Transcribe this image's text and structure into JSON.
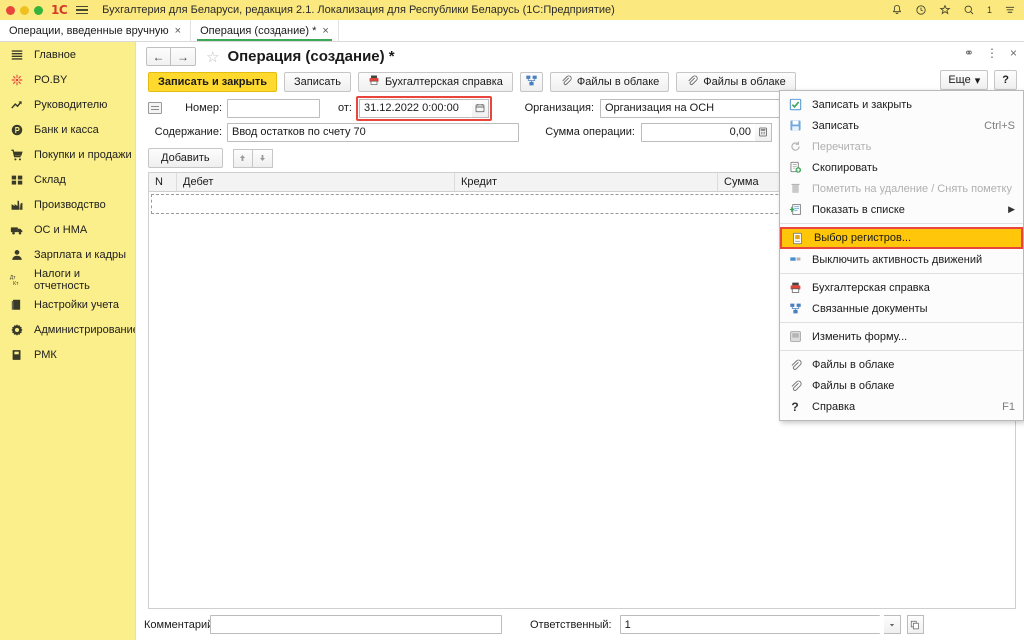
{
  "window": {
    "title": "Бухгалтерия для Беларуси, редакция 2.1. Локализация для Республики Беларусь   (1С:Предприятие)",
    "logo": "1С",
    "traffic_icons": [
      "close-red",
      "minimize-yellow",
      "zoom-green"
    ],
    "burger_icon": "hamburger-menu-icon",
    "right_icons": [
      {
        "name": "bell-icon",
        "glyph": "⚑"
      },
      {
        "name": "history-clock-icon",
        "glyph": "↺"
      },
      {
        "name": "favorites-star-icon",
        "glyph": "☆"
      },
      {
        "name": "search-icon",
        "glyph": "⚲"
      }
    ],
    "counter": "1",
    "menu_icon": "list-menu-icon"
  },
  "tabs": [
    {
      "label": "Операции, введенные вручную",
      "active": false,
      "close": "×"
    },
    {
      "label": "Операция (создание) *",
      "active": true,
      "close": "×"
    }
  ],
  "sidebar": {
    "items": [
      {
        "label": "Главное",
        "icon": "grid-lines-icon"
      },
      {
        "label": "РО.BY",
        "icon": "sparkle-icon"
      },
      {
        "label": "Руководителю",
        "icon": "trend-up-icon"
      },
      {
        "label": "Банк и касса",
        "icon": "coin-icon"
      },
      {
        "label": "Покупки и продажи",
        "icon": "cart-icon"
      },
      {
        "label": "Склад",
        "icon": "boxes-icon"
      },
      {
        "label": "Производство",
        "icon": "factory-icon"
      },
      {
        "label": "ОС и НМА",
        "icon": "truck-icon"
      },
      {
        "label": "Зарплата и кадры",
        "icon": "person-icon"
      },
      {
        "label": "Налоги и отчетность",
        "icon": "debit-credit-icon"
      },
      {
        "label": "Настройки учета",
        "icon": "books-icon"
      },
      {
        "label": "Администрирование",
        "icon": "gear-icon"
      },
      {
        "label": "РМК",
        "icon": "register-icon"
      }
    ]
  },
  "form": {
    "nav_back": "←",
    "nav_forward": "→",
    "favorite_star": "☆",
    "title": "Операция (создание) *",
    "header_actions": [
      {
        "name": "link-icon",
        "glyph": "⚭"
      },
      {
        "name": "more-vertical-icon",
        "glyph": "⋮"
      },
      {
        "name": "close-icon",
        "glyph": "×"
      }
    ],
    "toolbar": {
      "save_and_close": "Записать и закрыть",
      "save": "Записать",
      "accounting_reference": "Бухгалтерская справка",
      "print_icon": "printer-icon",
      "related_documents_icon": "related-documents-icon",
      "cloud_files_1": "Файлы в облаке",
      "cloud_files_2": "Файлы в облаке",
      "clip_icon": "paperclip-icon",
      "more": "Еще",
      "more_caret": "▾",
      "help": "?"
    },
    "fields": {
      "number_label": "Номер:",
      "number_value": "",
      "from_label": "от:",
      "date_value": "31.12.2022  0:00:00",
      "calendar_icon": "calendar-icon",
      "org_label": "Организация:",
      "org_value": "Организация на ОСН",
      "content_label": "Содержание:",
      "content_value": "Ввод остатков по счету 70",
      "sum_label": "Сумма операции:",
      "sum_value": "0,00",
      "sum_icon": "calculator-icon",
      "doc_icon": "document-icon"
    },
    "table_toolbar": {
      "add": "Добавить",
      "move_up_icon": "arrow-up-icon",
      "move_down_icon": "arrow-down-icon"
    },
    "table": {
      "columns": [
        "N",
        "Дебет",
        "Кредит",
        "Сумма"
      ],
      "rows": []
    },
    "footer": {
      "comment_label": "Комментарий:",
      "comment_value": "",
      "responsible_label": "Ответственный:",
      "responsible_value": "1",
      "dropdown_icon": "chevron-down-icon",
      "select_icon": "open-list-icon"
    }
  },
  "context_menu": {
    "items": [
      {
        "label": "Записать и закрыть",
        "icon": "save-close-icon",
        "shortcut": "",
        "state": "normal",
        "submenu": false
      },
      {
        "label": "Записать",
        "icon": "floppy-save-icon",
        "shortcut": "Ctrl+S",
        "state": "normal",
        "submenu": false
      },
      {
        "label": "Перечитать",
        "icon": "refresh-icon",
        "shortcut": "",
        "state": "disabled",
        "submenu": false
      },
      {
        "label": "Скопировать",
        "icon": "copy-icon",
        "shortcut": "",
        "state": "normal",
        "submenu": false
      },
      {
        "label": "Пометить на удаление / Снять пометку",
        "icon": "delete-mark-icon",
        "shortcut": "",
        "state": "disabled",
        "submenu": false
      },
      {
        "label": "Показать в списке",
        "icon": "show-in-list-icon",
        "shortcut": "",
        "state": "normal",
        "submenu": true
      },
      {
        "label": "Выбор регистров...",
        "icon": "registers-icon",
        "shortcut": "",
        "state": "selected",
        "submenu": false
      },
      {
        "label": "Выключить активность движений",
        "icon": "toggle-activity-icon",
        "shortcut": "",
        "state": "normal",
        "submenu": false
      },
      {
        "label": "Бухгалтерская справка",
        "icon": "printer-icon",
        "shortcut": "",
        "state": "normal",
        "submenu": false
      },
      {
        "label": "Связанные документы",
        "icon": "related-documents-icon",
        "shortcut": "",
        "state": "normal",
        "submenu": false
      },
      {
        "label": "Изменить форму...",
        "icon": "edit-form-icon",
        "shortcut": "",
        "state": "normal",
        "submenu": false
      },
      {
        "label": "Файлы в облаке",
        "icon": "paperclip-icon",
        "shortcut": "",
        "state": "normal",
        "submenu": false
      },
      {
        "label": "Файлы в облаке",
        "icon": "paperclip-icon",
        "shortcut": "",
        "state": "normal",
        "submenu": false
      },
      {
        "label": "Справка",
        "icon": "question-icon",
        "shortcut": "F1",
        "state": "normal",
        "submenu": false
      }
    ],
    "separators_after": [
      5,
      7,
      10,
      12
    ]
  },
  "colors": {
    "titlebar": "#fbe97f",
    "sidebar": "#fbef8c",
    "primary_button": "#ffd92e",
    "selection_highlight": "#ffc60a",
    "highlight_border": "#e8453c",
    "active_tab_underline": "#3aa856"
  }
}
